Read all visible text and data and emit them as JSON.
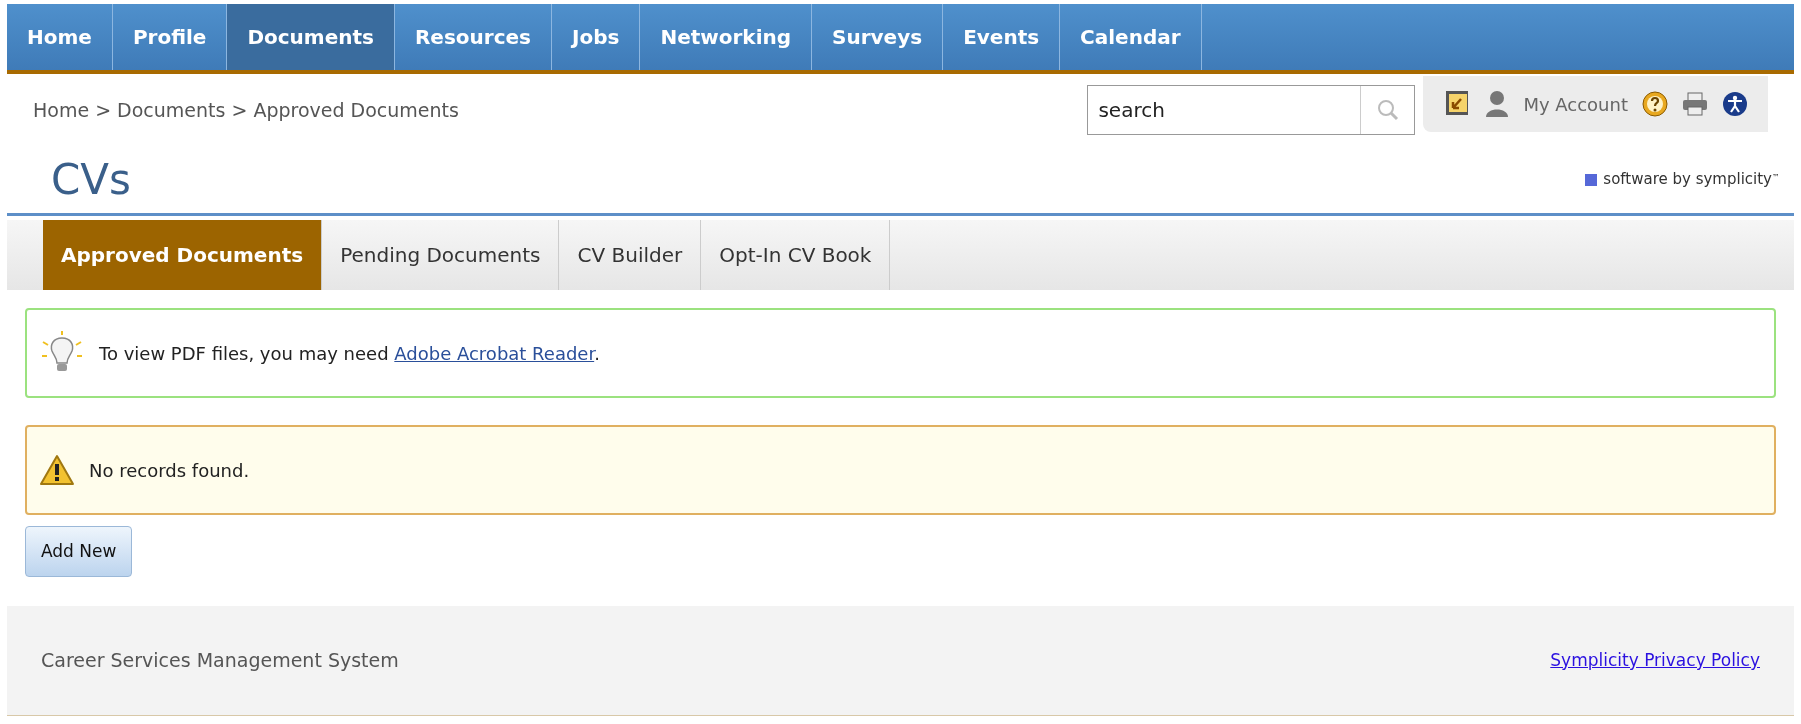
{
  "nav": [
    {
      "label": "Home",
      "selected": false
    },
    {
      "label": "Profile",
      "selected": false
    },
    {
      "label": "Documents",
      "selected": true
    },
    {
      "label": "Resources",
      "selected": false
    },
    {
      "label": "Jobs",
      "selected": false
    },
    {
      "label": "Networking",
      "selected": false
    },
    {
      "label": "Surveys",
      "selected": false
    },
    {
      "label": "Events",
      "selected": false
    },
    {
      "label": "Calendar",
      "selected": false
    }
  ],
  "breadcrumb": "Home > Documents > Approved Documents",
  "search": {
    "value": "search"
  },
  "account": {
    "label": "My Account"
  },
  "title": "CVs",
  "brand": {
    "text": "software by symplicity",
    "mark": "™"
  },
  "tabs": [
    {
      "label": "Approved Documents",
      "selected": true
    },
    {
      "label": "Pending Documents",
      "selected": false
    },
    {
      "label": "CV Builder",
      "selected": false
    },
    {
      "label": "Opt-In CV Book",
      "selected": false
    }
  ],
  "notices": [
    {
      "kind": "tip",
      "text": "To view PDF files, you may need ",
      "link": "Adobe Acrobat Reader",
      "after": "."
    },
    {
      "kind": "warning",
      "text": "No records found."
    }
  ],
  "add_button": "Add New",
  "footer": {
    "text": "Career Services Management System",
    "link": "Symplicity Privacy Policy"
  }
}
